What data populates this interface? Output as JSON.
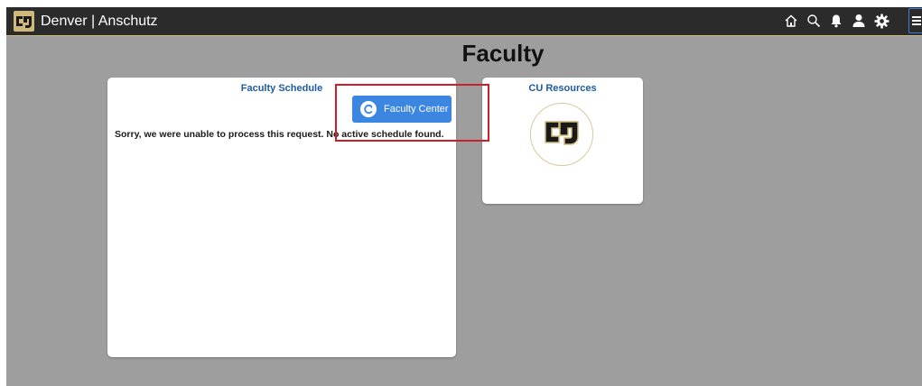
{
  "header": {
    "app_title": "Denver | Anschutz",
    "logo_icon": "cu-logo-icon",
    "icons": [
      "home-icon",
      "search-icon",
      "bell-icon",
      "user-icon",
      "gear-icon",
      "menu-icon"
    ]
  },
  "page": {
    "title": "Faculty"
  },
  "faculty_schedule": {
    "title": "Faculty Schedule",
    "button_label": "Faculty Center",
    "button_icon": "faculty-center-icon",
    "message": "Sorry, we were unable to process this request. No active schedule found."
  },
  "cu_resources": {
    "title": "CU Resources",
    "logo_icon": "cu-logo-icon"
  },
  "colors": {
    "header_bg": "#2b2b2b",
    "gold": "#cfb87c",
    "page_bg": "#9e9e9e",
    "link_blue": "#1f5aa6",
    "button_blue": "#3b86e0",
    "highlight_red": "#cc1f2a"
  }
}
